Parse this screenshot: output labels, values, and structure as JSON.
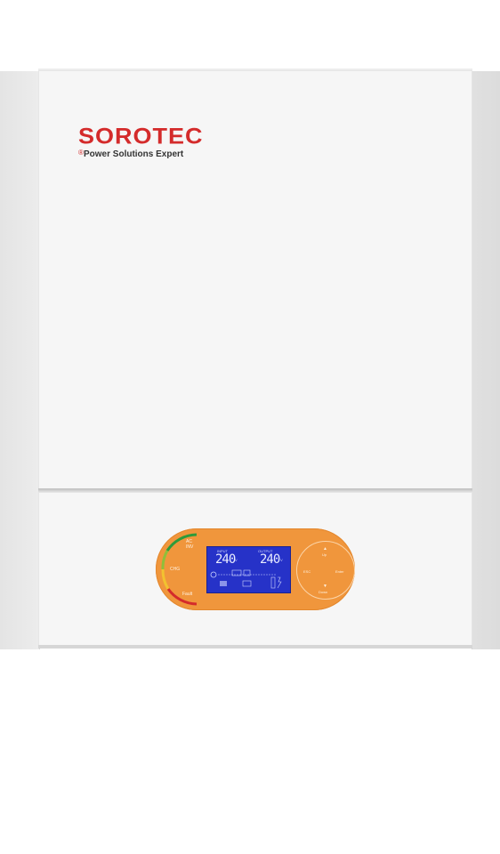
{
  "brand": {
    "name": "SOROTEC",
    "registered": "®",
    "tagline": "Power Solutions Expert",
    "color": "#d42b2b"
  },
  "panel": {
    "color": "#f0963c",
    "leds": [
      {
        "label": "AC",
        "color": "#2e9b3a"
      },
      {
        "label": "INV",
        "color": "#2e9b3a"
      },
      {
        "label": "CHG",
        "color": "#f2c230"
      },
      {
        "label": "Fault",
        "color": "#d42b2b"
      }
    ],
    "lcd": {
      "color": "#2632c8",
      "input_label": "INPUT",
      "output_label": "OUTPUT",
      "input_value": "240",
      "output_value": "240",
      "input_unit": "V",
      "output_unit": "V"
    },
    "buttons": {
      "up": "Up",
      "down": "Down",
      "esc": "ESC",
      "enter": "Enter"
    }
  }
}
